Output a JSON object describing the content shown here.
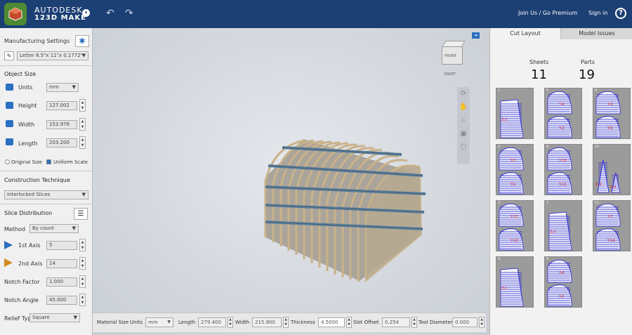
{
  "app": {
    "brand_line1": "AUTODESK",
    "brand_line2": "123D MAKE"
  },
  "topbar": {
    "join_label": "Join Us / Go Premium",
    "signin_label": "Sign in",
    "help_label": "?"
  },
  "left": {
    "manufacturing_label": "Manufacturing Settings",
    "sheet_value": "Letter 8.5\"x 11\"x 0.1772\"",
    "object_size_header": "Object Size",
    "units_label": "Units",
    "units_value": "mm",
    "height_label": "Height",
    "height_value": "127.002",
    "width_label": "Width",
    "width_value": "153.976",
    "length_label": "Length",
    "length_value": "203.200",
    "original_size_label": "Original Size",
    "uniform_scale_label": "Uniform Scale",
    "construction_header": "Construction Technique",
    "construction_value": "Interlocked Slices",
    "slice_dist_header": "Slice Distribution",
    "method_label": "Method",
    "method_value": "By count",
    "axis1_label": "1st Axis",
    "axis1_value": "5",
    "axis2_label": "2nd Axis",
    "axis2_value": "14",
    "notch_factor_label": "Notch Factor",
    "notch_factor_value": "1.000",
    "notch_angle_label": "Notch Angle",
    "notch_angle_value": "45.000",
    "relief_label": "Relief Type",
    "relief_value": "Square"
  },
  "bottom": {
    "material_size_label": "Material Size",
    "units_label": "Units",
    "units_value": "mm",
    "length_label": "Length",
    "length_value": "279.400",
    "width_label": "Width",
    "width_value": "215.900",
    "thickness_label": "Thickness",
    "thickness_value": "4.5000",
    "slot_label": "Slot Offset",
    "slot_value": "0.254",
    "tool_label": "Tool Diameter",
    "tool_value": "0.000"
  },
  "viewcube": {
    "front": "FRONT",
    "right": "RIGHT"
  },
  "right": {
    "tab_cut_layout": "Cut Layout",
    "tab_model_issues": "Model Issues",
    "sheets_label": "Sheets",
    "sheets_value": "11",
    "parts_label": "Parts",
    "parts_value": "19",
    "sheets": [
      {
        "number": "1",
        "labels": [
          "Z-2"
        ]
      },
      {
        "number": "2",
        "labels": [
          "Y-2",
          "Y-1"
        ]
      },
      {
        "number": "3",
        "labels": [
          "Y-12",
          "Y-13"
        ]
      },
      {
        "number": "4",
        "labels": [
          "Z-1"
        ]
      },
      {
        "number": "5",
        "labels": [
          "Y-4",
          "Y-3"
        ]
      },
      {
        "number": "6",
        "labels": [
          "Y-10",
          "Y-11"
        ]
      },
      {
        "number": "7",
        "labels": [
          "Z-3"
        ]
      },
      {
        "number": "8",
        "labels": [
          "Y-6",
          "Y-5"
        ]
      },
      {
        "number": "9",
        "labels": [
          "Y-9",
          "Y-8"
        ]
      },
      {
        "number": "10",
        "labels": [
          "Z-4",
          "Z-5"
        ]
      },
      {
        "number": "11",
        "labels": [
          "Y-7",
          "Y-14"
        ]
      }
    ]
  },
  "colors": {
    "topbar": "#1c3f74",
    "accent": "#2a6fc1",
    "slice_line": "#1a1ae0",
    "part_label": "#e02020"
  }
}
